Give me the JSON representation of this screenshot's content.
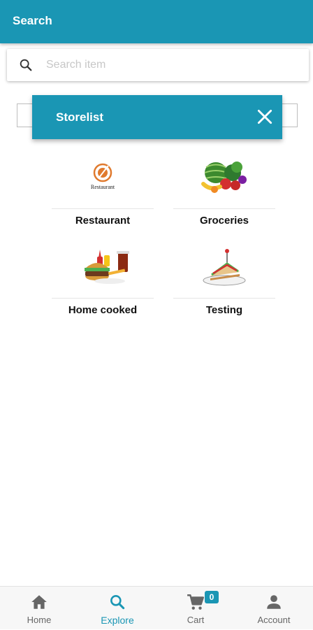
{
  "app_bar": {
    "title": "Search"
  },
  "search": {
    "placeholder": "Search item",
    "value": ""
  },
  "dialog": {
    "title": "Storelist"
  },
  "stores": [
    {
      "label": "Restaurant",
      "logo_text": "Restaurant"
    },
    {
      "label": "Groceries"
    },
    {
      "label": "Home cooked"
    },
    {
      "label": "Testing"
    }
  ],
  "bottom_nav": {
    "items": [
      {
        "label": "Home",
        "icon": "home-icon",
        "active": false
      },
      {
        "label": "Explore",
        "icon": "search-icon",
        "active": true
      },
      {
        "label": "Cart",
        "icon": "cart-icon",
        "active": false,
        "badge": "0"
      },
      {
        "label": "Account",
        "icon": "account-icon",
        "active": false
      }
    ]
  },
  "colors": {
    "primary": "#1a96b4",
    "nav_inactive": "#666666",
    "background": "#ffffff"
  }
}
